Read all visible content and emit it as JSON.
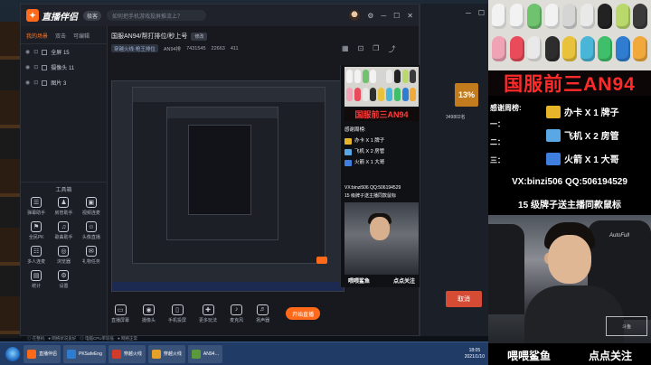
{
  "app": {
    "name": "直播伴侣",
    "version_badge": "极客",
    "help_search": "如何把手机游戏投屏推流上？",
    "titlebar_icons": [
      "⚙",
      "─",
      "☐",
      "✕"
    ]
  },
  "scenes": {
    "tabs": [
      "我的场景",
      "双击",
      "可编辑"
    ],
    "items": [
      {
        "label": "全屏 15"
      },
      {
        "label": "摄像头 11"
      },
      {
        "label": "图片 3"
      }
    ]
  },
  "toolbox": {
    "title": "工具箱",
    "tools": [
      {
        "label": "弹幕助手",
        "icon": "☰"
      },
      {
        "label": "房管助手",
        "icon": "♟"
      },
      {
        "label": "视频连麦",
        "icon": "▣"
      },
      {
        "label": "全民PK",
        "icon": "⚑"
      },
      {
        "label": "歌曲助手",
        "icon": "♫"
      },
      {
        "label": "头像直播",
        "icon": "☺"
      },
      {
        "label": "多人连麦",
        "icon": "☷"
      },
      {
        "label": "浏览器",
        "icon": "◎"
      },
      {
        "label": "礼物任务",
        "icon": "✉"
      },
      {
        "label": "统计",
        "icon": "▤"
      },
      {
        "label": "设置",
        "icon": "⚙"
      }
    ]
  },
  "room": {
    "title": "国服AN94/帮打排位/秒上号",
    "edit_label": "修改",
    "game_tag": "穿越火线·枪王排位",
    "room_id": "AN94排",
    "viewers": "7431545",
    "likes": "22663",
    "fans": "411"
  },
  "controls": {
    "items": [
      {
        "label": "直播屏幕",
        "icon": "▭"
      },
      {
        "label": "摄像头",
        "icon": "◉"
      },
      {
        "label": "手机投屏",
        "icon": "▯"
      },
      {
        "label": "更多玩法",
        "icon": "✚"
      },
      {
        "label": "麦克风",
        "icon": "♪"
      },
      {
        "label": "扬声器",
        "icon": "♬"
      }
    ],
    "start_live": "开始直播"
  },
  "statusbar": [
    "◎ 在整机",
    "● 网络状况良好",
    "◎ 电脑CPU率较低",
    "● 网络正常"
  ],
  "bg_window": {
    "percent": "13%",
    "count": "349802名",
    "cancel": "取消"
  },
  "taskbar": {
    "buttons": [
      {
        "label": "直播伴侣",
        "color": "#ff6a1a"
      },
      {
        "label": "PKSafeEng",
        "color": "#2f7dd1"
      },
      {
        "label": "穿越火线",
        "color": "#d23a2a"
      },
      {
        "label": "穿越火线",
        "color": "#e6a12a"
      },
      {
        "label": "AN94…",
        "color": "#5b9a3c"
      }
    ],
    "time": "18:05",
    "date": "2021/1/10"
  },
  "stream": {
    "title": "国服前三AN94",
    "thanks_title": "感谢周榜:",
    "slots": [
      "一：",
      "二：",
      "三："
    ],
    "gifts": [
      {
        "label": "办卡 X 1 牌子",
        "color": "#e7b52a"
      },
      {
        "label": "飞机 X 2 房管",
        "color": "#5aa7e6"
      },
      {
        "label": "火箭 X 1 大哥",
        "color": "#3f7fe0"
      }
    ],
    "contact": "VX:binzi506  QQ:506194529",
    "promo": "15 级牌子送主播同款鼠标",
    "cam_brand": "AutoFull",
    "watermark": "斗鱼",
    "caption_left": "喂喂鲨鱼",
    "caption_right": "点点关注"
  },
  "mouse_colors": [
    "#f2f2f2",
    "#f2f2f2",
    "#6fc36f",
    "#f2f2f2",
    "#d5d5d5",
    "#e9e9e9",
    "#222222",
    "#b9d96d",
    "#3a3a3a",
    "#f0a3b4",
    "#e94b5a",
    "#e9e9e9",
    "#2d2d2d",
    "#e8c23a",
    "#49b6d8",
    "#3fbf6a",
    "#2f7dd1",
    "#f0a93a"
  ],
  "colors": {
    "accent": "#ff6a1a",
    "title_red": "#ff2a2a",
    "app_bg": "#17191f"
  }
}
